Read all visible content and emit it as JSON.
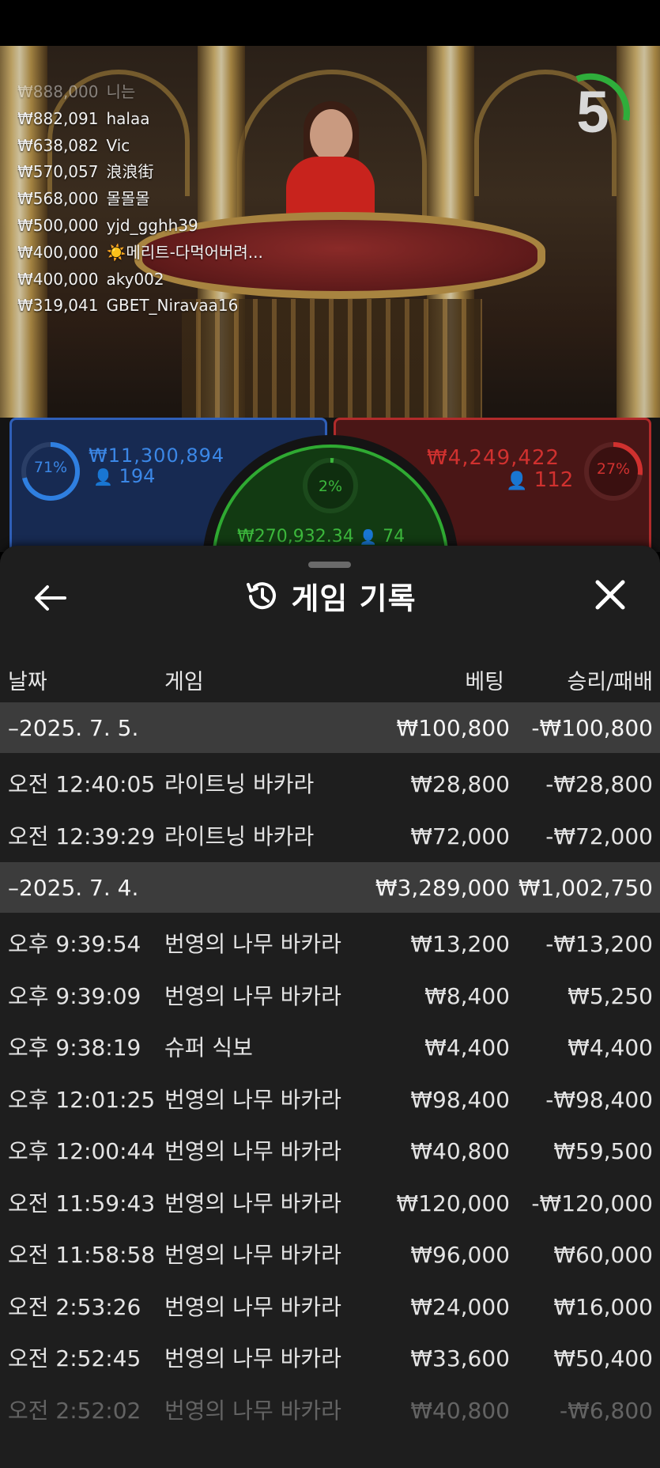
{
  "timer": {
    "value": "5"
  },
  "leaderboard": [
    {
      "amount": "₩888,000",
      "name": "니는",
      "faded": true
    },
    {
      "amount": "₩882,091",
      "name": "halaa"
    },
    {
      "amount": "₩638,082",
      "name": "Vic"
    },
    {
      "amount": "₩570,057",
      "name": "浪浪街"
    },
    {
      "amount": "₩568,000",
      "name": "몰몰몰"
    },
    {
      "amount": "₩500,000",
      "name": "yjd_gghh39"
    },
    {
      "amount": "₩400,000",
      "name": "☀️메리트-다먹어버려..."
    },
    {
      "amount": "₩400,000",
      "name": "aky002"
    },
    {
      "amount": "₩319,041",
      "name": "GBET_Niravaa16"
    }
  ],
  "bets": {
    "player": {
      "percent": "71%",
      "amount": "₩11,300,894",
      "players": "194",
      "color": "#2f7fe0"
    },
    "banker": {
      "percent": "27%",
      "amount": "₩4,249,422",
      "players": "112",
      "color": "#d0312f"
    },
    "tie": {
      "percent": "2%",
      "amount": "₩270,932.34",
      "players": "74",
      "color": "#3cb83c"
    }
  },
  "history": {
    "title": "게임 기록",
    "columns": {
      "date": "날짜",
      "game": "게임",
      "bet": "베팅",
      "result": "승리/패배"
    },
    "groups": [
      {
        "date": "–2025. 7. 5.",
        "bet": "₩100,800",
        "result": "-₩100,800",
        "rows": [
          {
            "time": "오전 12:40:05",
            "game": "라이트닝 바카라",
            "bet": "₩28,800",
            "result": "-₩28,800"
          },
          {
            "time": "오전 12:39:29",
            "game": "라이트닝 바카라",
            "bet": "₩72,000",
            "result": "-₩72,000"
          }
        ]
      },
      {
        "date": "–2025. 7. 4.",
        "bet": "₩3,289,000",
        "result": "₩1,002,750",
        "rows": [
          {
            "time": "오후 9:39:54",
            "game": "번영의 나무 바카라",
            "bet": "₩13,200",
            "result": "-₩13,200"
          },
          {
            "time": "오후 9:39:09",
            "game": "번영의 나무 바카라",
            "bet": "₩8,400",
            "result": "₩5,250"
          },
          {
            "time": "오후 9:38:19",
            "game": "슈퍼 식보",
            "bet": "₩4,400",
            "result": "₩4,400"
          },
          {
            "time": "오후 12:01:25",
            "game": "번영의 나무 바카라",
            "bet": "₩98,400",
            "result": "-₩98,400"
          },
          {
            "time": "오후 12:00:44",
            "game": "번영의 나무 바카라",
            "bet": "₩40,800",
            "result": "₩59,500"
          },
          {
            "time": "오전 11:59:43",
            "game": "번영의 나무 바카라",
            "bet": "₩120,000",
            "result": "-₩120,000"
          },
          {
            "time": "오전 11:58:58",
            "game": "번영의 나무 바카라",
            "bet": "₩96,000",
            "result": "₩60,000"
          },
          {
            "time": "오전 2:53:26",
            "game": "번영의 나무 바카라",
            "bet": "₩24,000",
            "result": "₩16,000"
          },
          {
            "time": "오전 2:52:45",
            "game": "번영의 나무 바카라",
            "bet": "₩33,600",
            "result": "₩50,400"
          },
          {
            "time": "오전 2:52:02",
            "game": "번영의 나무 바카라",
            "bet": "₩40,800",
            "result": "-₩6,800",
            "faded": true
          }
        ]
      }
    ]
  }
}
